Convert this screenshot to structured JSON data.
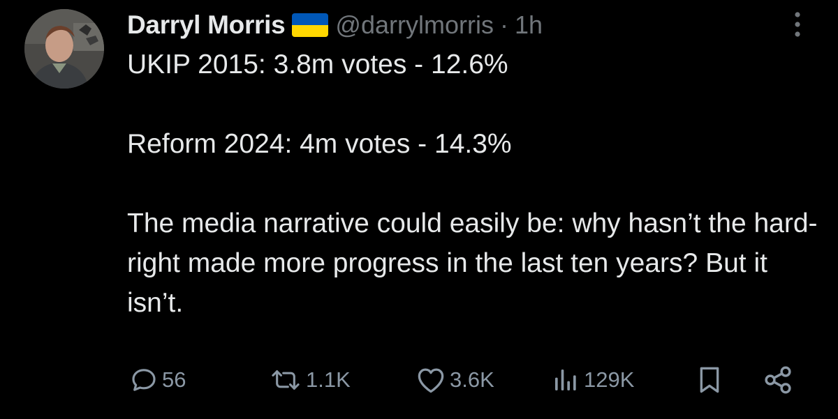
{
  "author": {
    "display_name": "Darryl Morris",
    "flag_icon": "ukraine-flag-icon",
    "handle": "@darrylmorris",
    "separator": "·",
    "time": "1h"
  },
  "tweet": {
    "line1": "UKIP 2015: 3.8m votes - 12.6%",
    "line2": "Reform 2024: 4m votes - 14.3%",
    "line3": "The media narrative could easily be: why hasn’t the hard-right made more progress in the last ten years? But it isn’t."
  },
  "actions": {
    "replies": "56",
    "reposts": "1.1K",
    "likes": "3.6K",
    "views": "129K"
  },
  "colors": {
    "background": "#000000",
    "text": "#e7e9ea",
    "secondary": "#71767b",
    "flag_blue": "#0057b7",
    "flag_yellow": "#ffd700"
  }
}
